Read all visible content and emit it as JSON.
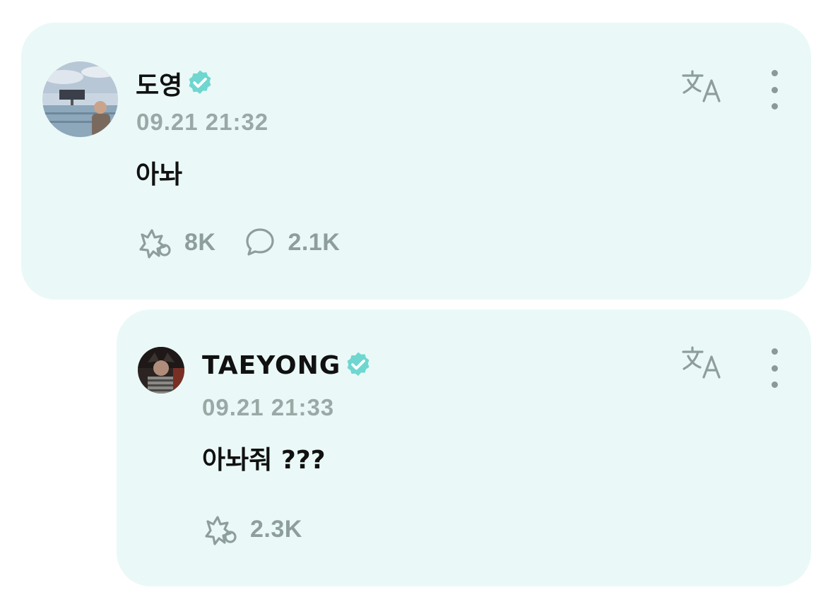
{
  "post": {
    "author": "도영",
    "timestamp": "09.21 21:32",
    "text": "아놔",
    "likes": "8K",
    "comments": "2.1K",
    "verified_icon": "verified-badge-icon",
    "translate_icon": "translate-icon",
    "more_icon": "more-vertical-icon"
  },
  "reply": {
    "author": "TAEYONG",
    "timestamp": "09.21 21:33",
    "text": "아놔줘 ???",
    "likes": "2.3K",
    "verified_icon": "verified-badge-icon",
    "translate_icon": "translate-icon",
    "more_icon": "more-vertical-icon"
  },
  "colors": {
    "card_background": "#eaf9f7",
    "verified": "#6fd6d0",
    "muted_text": "#9aa8a6",
    "primary_text": "#111111"
  }
}
